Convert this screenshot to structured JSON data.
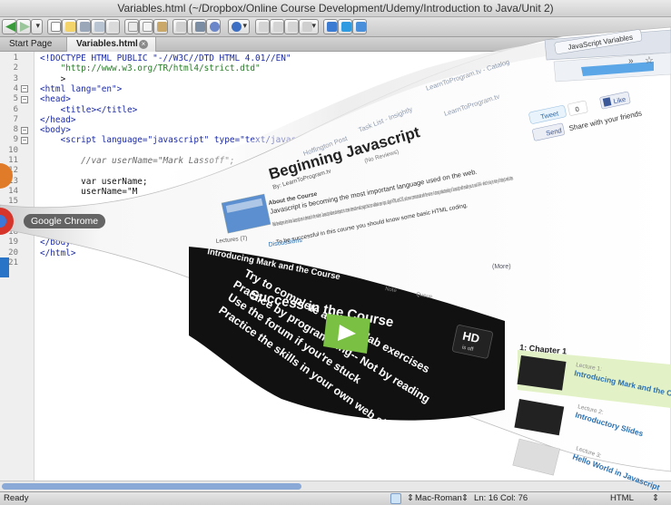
{
  "window": {
    "title": "Variables.html (~/Dropbox/Online Course Development/Udemy/Introduction to Java/Unit 2)"
  },
  "tabs": [
    {
      "label": "Start Page",
      "active": false
    },
    {
      "label": "Variables.html",
      "active": true
    }
  ],
  "editor": {
    "line_numbers": [
      "1",
      "2",
      "3",
      "4",
      "5",
      "6",
      "7",
      "8",
      "9",
      "10",
      "11",
      "12",
      "13",
      "14",
      "15",
      "16",
      "17",
      "18",
      "19",
      "20",
      "21"
    ],
    "lines": [
      "<!DOCTYPE HTML PUBLIC \"-//W3C//DTD HTML 4.01//EN\"",
      "    \"http://www.w3.org/TR/html4/strict.dtd\"",
      "    >",
      "<html lang=\"en\">",
      "<head>",
      "    <title></title>",
      "</head>",
      "<body>",
      "    <script language=\"javascript\" type=\"text/javascript\">",
      "",
      "        //var userName=\"Mark Lassoff\";",
      "",
      "        var userName;",
      "        userName=\"M",
      "",
      "",
      "",
      "",
      "</body>",
      "</html>",
      ""
    ]
  },
  "dock": {
    "hover_label": "Google Chrome"
  },
  "webpage": {
    "browser_tab": "JavaScript Variables",
    "back_tabs": [
      "LearnToProgram.tv - Catalog",
      "Task List - Insightly",
      "LearnToProgram.tv",
      "Hoffington Post"
    ],
    "tweet_label": "Tweet",
    "tweet_count": "0",
    "like_label": "Like",
    "send_label": "Send",
    "share_text": "Share with your friends",
    "course_title": "Beginning Javascript",
    "byline": "By: LearnToProgram.tv",
    "reviews": "(No Reviews)",
    "about_heading": "About the Course",
    "para1": "Javascript is becoming the most important language used on the web.",
    "para2": "Web developers who know Javascript are in demand in the market. Javascript allows developers to create interactive web pages that can validate user input, adjust HTML and CSS, and even communicate with the server. A strong understanding of Javascript with enable you to use AJAX-- which is key to many of today's web sites.",
    "para3": "To be successful in this course you should know some basic HTML coding.",
    "more": "(More)",
    "discussions": "Discussions",
    "tab_lectures": "Lectures (7)",
    "video_header": "Introducing Mark and the Course",
    "slide_title": "Success in the Course",
    "slide_bullets": [
      "Try to complete all of the lab exercises",
      "Practice by programming-- Not by reading",
      "Use the forum if you're stuck",
      "Practice the skills in your own web sites and"
    ],
    "hd_label": "HD",
    "hd_sub": "is off",
    "note_label": "Note",
    "queue_label": "Queue",
    "chapter": "1: Chapter 1",
    "lectures": [
      {
        "num": "Lecture 1:",
        "title": "Introducing Mark and the Course"
      },
      {
        "num": "Lecture 2:",
        "title": "Introductory Slides"
      },
      {
        "num": "Lecture 3:",
        "title": "Hello World in Javascript"
      }
    ]
  },
  "status": {
    "ready": "Ready",
    "encoding": "Mac-Roman",
    "position": "Ln: 16 Col: 76",
    "syntax": "HTML"
  },
  "colors": {
    "link_blue": "#1b2aa8",
    "string_green": "#2b7a2b",
    "chrome_red": "#d6352b",
    "slide_bg": "#111111",
    "play_green": "#7ac143",
    "lecture_highlight": "#e3f2c6"
  }
}
